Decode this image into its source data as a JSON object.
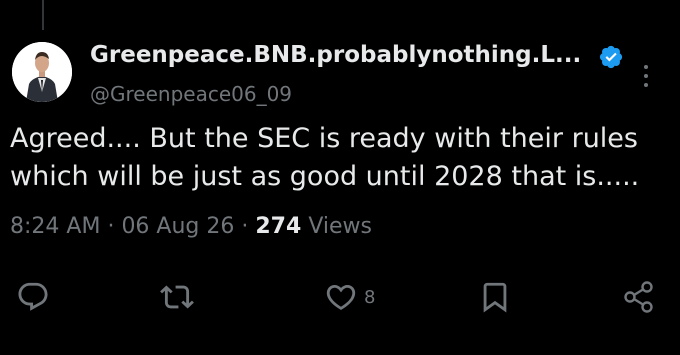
{
  "tweet": {
    "display_name": "Greenpeace.BNB.probablynothing.L...",
    "handle": "@Greenpeace06_09",
    "text_line1": "Agreed.... But the SEC is ready with their rules",
    "text_line2": "which will be just as good until 2028 that is.....",
    "time": "8:24 AM",
    "date": "06 Aug 26",
    "separator": "·",
    "views_count": "274",
    "views_label": "Views"
  },
  "actions": {
    "like_count": "8"
  },
  "icons": {
    "verified": "verified-badge-icon",
    "more": "more-vertical-icon",
    "reply": "reply-icon",
    "retweet": "retweet-icon",
    "like": "heart-icon",
    "bookmark": "bookmark-icon",
    "share": "share-icon"
  },
  "colors": {
    "background": "#000000",
    "text": "#e7e9ea",
    "secondary_text": "#71767b",
    "verified": "#1d9bf0"
  }
}
